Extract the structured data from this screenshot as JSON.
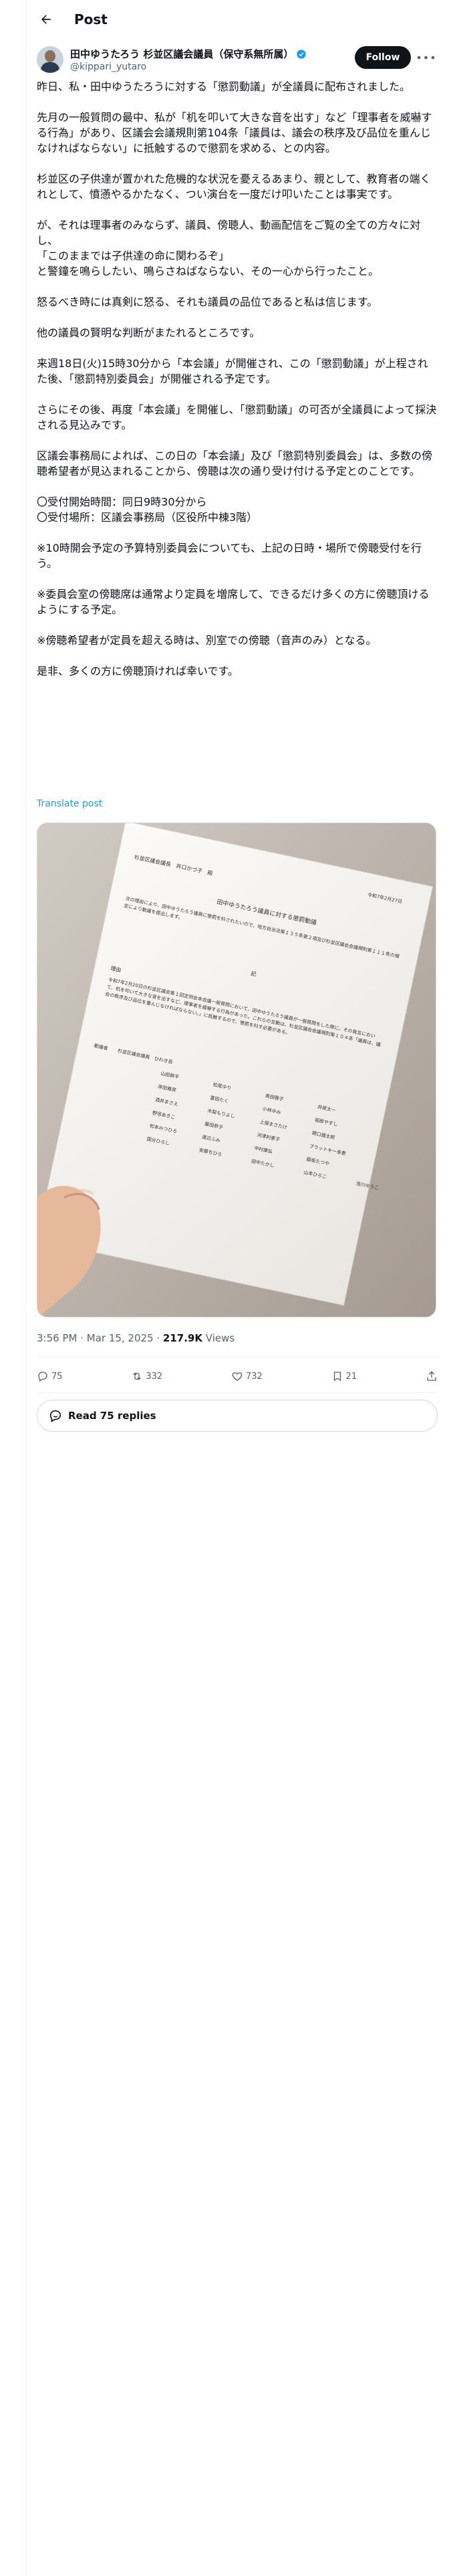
{
  "header": {
    "title": "Post"
  },
  "author": {
    "name": "田中ゆうたろう 杉並区議会議員（保守系無所属）",
    "handle": "@kippari_yutaro",
    "follow_label": "Follow"
  },
  "post": {
    "paragraphs": [
      "昨日、私・田中ゆうたろうに対する「懲罰動議」が全議員に配布されました。",
      "先月の一般質問の最中、私が「机を叩いて大きな音を出す」など「理事者を威嚇する行為」があり、区議会会議規則第104条「議員は、議会の秩序及び品位を重んじなければならない」に抵触するので懲罰を求める、との内容。",
      "杉並区の子供達が置かれた危機的な状況を憂えるあまり、親として、教育者の端くれとして、憤懣やるかたなく、つい演台を一度だけ叩いたことは事実です。",
      "が、それは理事者のみならず、議員、傍聴人、動画配信をご覧の全ての方々に対し、\n「このままでは子供達の命に関わるぞ」\nと警鐘を鳴らしたい、鳴らさねばならない、その一心から行ったこと。",
      "怒るべき時には真剣に怒る、それも議員の品位であると私は信じます。",
      "他の議員の賢明な判断がまたれるところです。",
      "来週18日(火)15時30分から「本会議」が開催され、この「懲罰動議」が上程された後、「懲罰特別委員会」が開催される予定です。",
      "さらにその後、再度「本会議」を開催し、「懲罰動議」の可否が全議員によって採決される見込みです。",
      "区議会事務局によれば、この日の「本会議」及び「懲罰特別委員会」は、多数の傍聴希望者が見込まれることから、傍聴は次の通り受け付ける予定とのことです。",
      "〇受付開始時間：同日9時30分から\n〇受付場所：区議会事務局（区役所中棟3階）",
      "※10時開会予定の予算特別委員会についても、上記の日時・場所で傍聴受付を行う。",
      "※委員会室の傍聴席は通常より定員を増席して、できるだけ多くの方に傍聴頂けるようにする予定。",
      "※傍聴希望者が定員を超える時は、別室での傍聴（音声のみ）となる。",
      "是非、多くの方に傍聴頂ければ幸いです。"
    ],
    "translate_label": "Translate post"
  },
  "document": {
    "date": "令和7年2月27日",
    "addressee": "杉並区議会議長　井口かづ子　殿",
    "title": "田中ゆうたろう議員に対する懲罰動議",
    "intro": "次の理由により、田中ゆうたろう議員に懲罰を科されたいので、地方自治法第１３５条第２項及び杉並区議会会議規則第１１１条の規定により動議を提出します。",
    "note_label": "記",
    "reason_label": "理由",
    "reason": "令和7年2月20日の杉並区議会第１回定例会本会議一般質問において、田中ゆうたろう議員が一般質問をした際に、その発言において、机を叩いて大きな音を出すなど、理事者を威嚇する行為があった。これらの言動は、杉並区議会会議規則第１０４条「議員は、議会の秩序及び品位を重んじなければならない。」に抵触するので、懲罰を科す必要がある。",
    "proposer_label": "動議者",
    "proposers": [
      "杉並区議会議員　ひわき岳",
      "山田耕平",
      "松尾ゆり",
      "奥田雅子",
      "井原太一",
      "岸田雅彦",
      "富田たく",
      "小林ゆみ",
      "堀部やすし",
      "酒井まさえ",
      "木梨もりよし",
      "上保まさたけ",
      "関口健太郎",
      "野垣あきこ",
      "藤田恭子",
      "河津利恵子",
      "ブラットキー幸恵",
      "松本みつひろ",
      "渡辺ふみ",
      "中村康弘",
      "脇坂たつや",
      "国分ひろし",
      "安藤ちひろ",
      "田中たかし",
      "山本ひろこ",
      "浅川ゆうこ"
    ]
  },
  "meta": {
    "time": "3:56 PM · Mar 15, 2025 · ",
    "views_count": "217.9K",
    "views_label": " Views"
  },
  "actions": {
    "replies": "75",
    "reposts": "332",
    "likes": "732",
    "bookmarks": "21"
  },
  "read_replies_label": "Read 75 replies",
  "colors": {
    "accent": "#1d9bf0",
    "text": "#0f1419",
    "muted": "#536471",
    "border": "#cfd9de"
  }
}
